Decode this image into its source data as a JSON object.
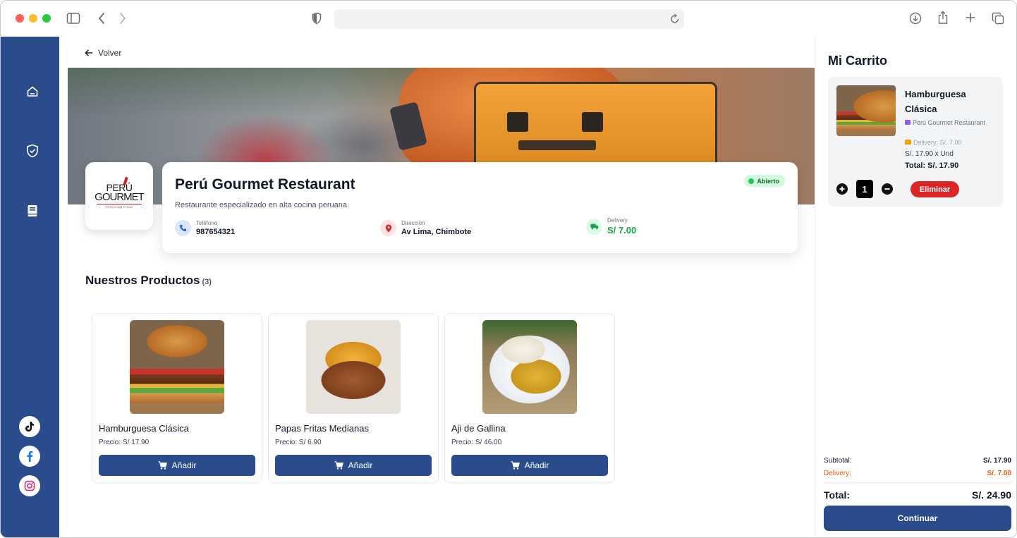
{
  "browser": {
    "url": "",
    "icons": [
      "sidebar-toggle-icon",
      "back-icon",
      "forward-icon",
      "shield-icon",
      "reload-icon",
      "download-icon",
      "share-icon",
      "new-tab-icon",
      "tabs-icon"
    ]
  },
  "sidebar": {
    "nav": [
      "home-icon",
      "shield-check-icon",
      "book-icon"
    ],
    "social": [
      "tiktok-icon",
      "facebook-icon",
      "instagram-icon"
    ]
  },
  "header": {
    "back_label": "Volver"
  },
  "restaurant": {
    "logo": {
      "line1": "PERÚ",
      "line2": "GOURMET",
      "line3": "PERUVIAN FOOD"
    },
    "name": "Perú Gourmet Restaurant",
    "status": "Abierto",
    "description": "Restaurante especializado en alta cocina peruana.",
    "phone_label": "Teléfono",
    "phone": "987654321",
    "address_label": "Dirección",
    "address": "Av Lima, Chimbote",
    "delivery_label": "Delivery",
    "delivery": "S/ 7.00",
    "colors": {
      "accent": "#2a4c8d",
      "open": "#22c55e"
    }
  },
  "products_section": {
    "title": "Nuestros Productos",
    "count": "(3)"
  },
  "products": [
    {
      "name": "Hamburguesa Clásica",
      "price": "Precio: S/ 17.90",
      "button": "Añadir"
    },
    {
      "name": "Papas Fritas Medianas",
      "price": "Precio: S/ 6.90",
      "button": "Añadir"
    },
    {
      "name": "Aji de Gallina",
      "price": "Precio: S/ 46.00",
      "button": "Añadir"
    }
  ],
  "cart": {
    "title": "Mi Carrito",
    "item": {
      "name": "Hamburguesa Clásica",
      "restaurant": "Perú Gourmet Restaurant",
      "delivery": "Delivery: S/. 7.00",
      "unit_price": "S/. 17.90 x Und",
      "total": "Total: S/. 17.90",
      "quantity": "1",
      "remove": "Eliminar"
    },
    "subtotal_label": "Subtotal:",
    "subtotal": "S/. 17.90",
    "delivery_label": "Delivery:",
    "delivery": "S/. 7.00",
    "total_label": "Total:",
    "total": "S/. 24.90",
    "continue": "Continuar"
  }
}
